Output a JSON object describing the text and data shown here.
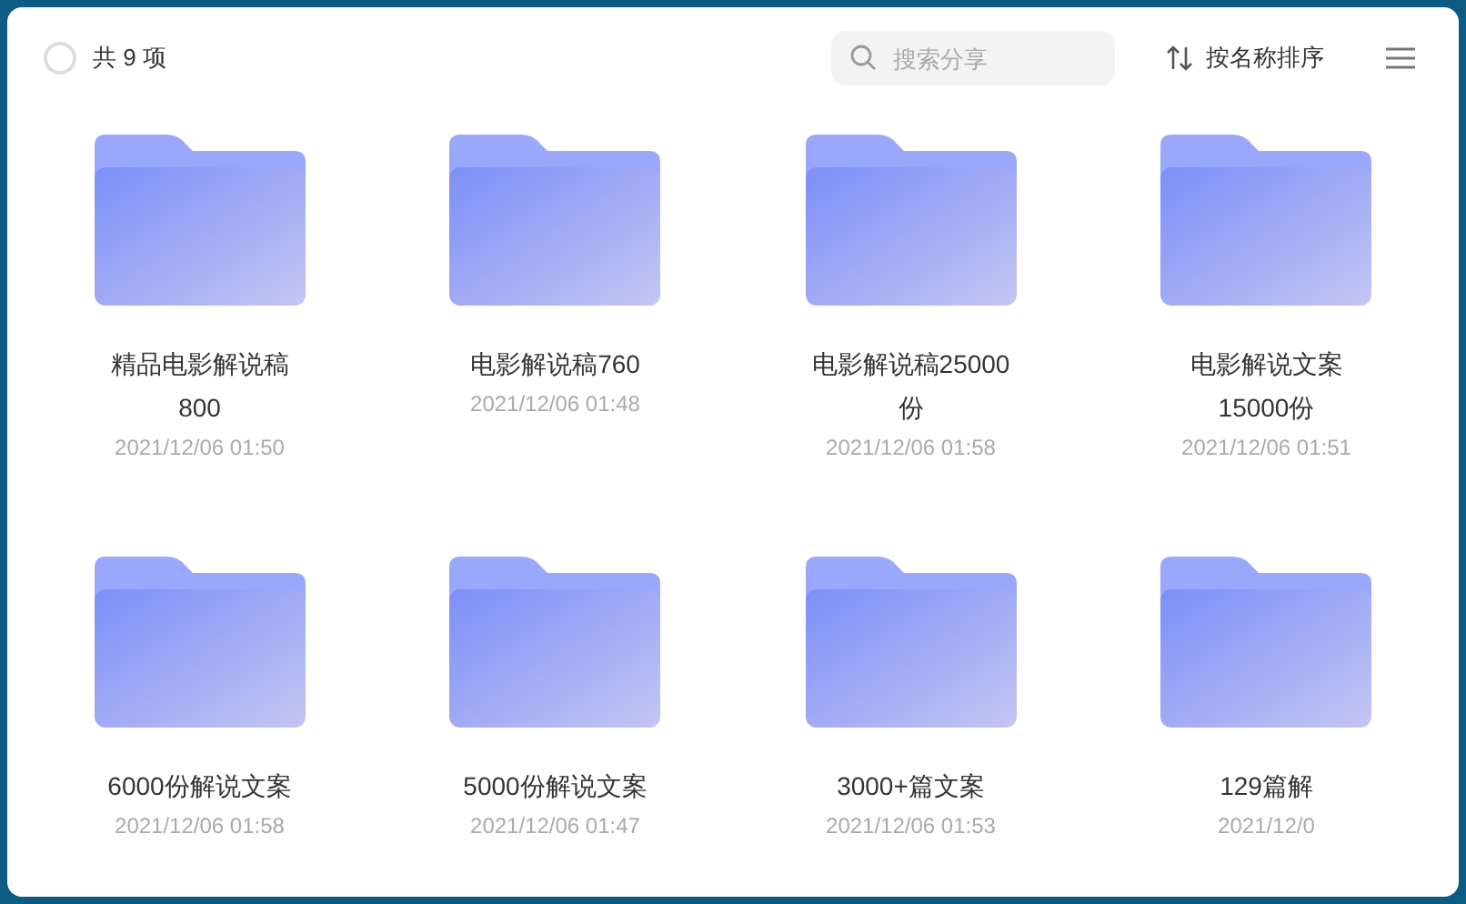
{
  "header": {
    "select_all": {
      "checked": false
    },
    "count": "共 9 项",
    "search": {
      "placeholder": "搜索分享"
    },
    "sort": "按名称排序"
  },
  "folders": [
    {
      "name": "精品电影解说稿800",
      "date": "2021/12/06 01:50"
    },
    {
      "name": "电影解说稿760",
      "date": "2021/12/06 01:48"
    },
    {
      "name": "电影解说稿25000份",
      "date": "2021/12/06 01:58"
    },
    {
      "name": "电影解说文案15000份",
      "date": "2021/12/06 01:51"
    },
    {
      "name": "6000份解说文案",
      "date": "2021/12/06 01:58"
    },
    {
      "name": "5000份解说文案",
      "date": "2021/12/06 01:47"
    },
    {
      "name": "3000+篇文案",
      "date": "2021/12/06 01:53"
    },
    {
      "name": "129篇解",
      "date": "2021/12/0"
    }
  ]
}
